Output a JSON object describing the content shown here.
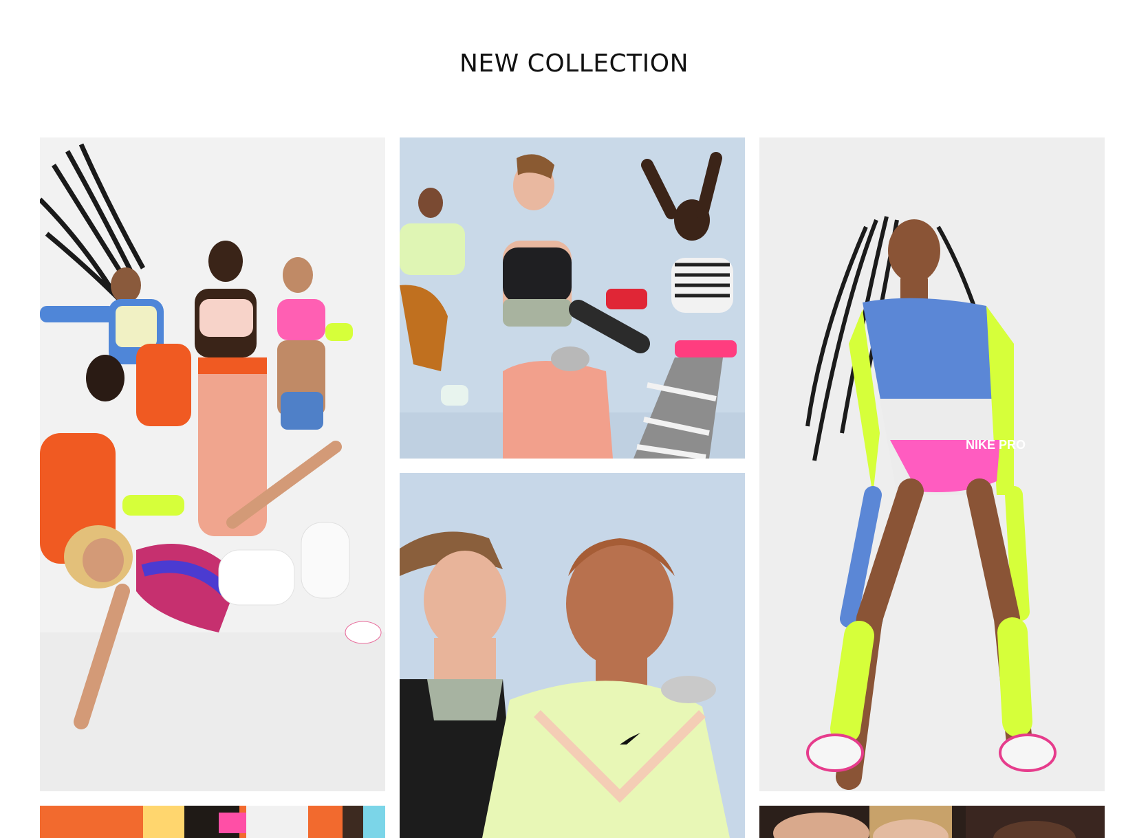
{
  "page": {
    "title": "NEW COLLECTION"
  },
  "colors": {
    "background": "#ffffff",
    "title_text": "#111111",
    "tile_light_gray": "#f1f1f1",
    "tile_light_blue": "#c9d8e8",
    "tile_orange": "#f26a2e",
    "tile_dark": "#2a1f1b"
  },
  "gallery": {
    "tiles": [
      {
        "id": "group-dance-photo",
        "icon": "photo-icon"
      },
      {
        "id": "three-athletes-photo",
        "icon": "photo-icon"
      },
      {
        "id": "solo-bodysuit-photo",
        "icon": "photo-icon",
        "print_text": "NIKE PRO"
      },
      {
        "id": "portrait-duo-photo",
        "icon": "photo-icon"
      },
      {
        "id": "orange-outfit-photo-partial",
        "icon": "photo-icon"
      },
      {
        "id": "portrait-partial-photo",
        "icon": "photo-icon"
      }
    ]
  }
}
